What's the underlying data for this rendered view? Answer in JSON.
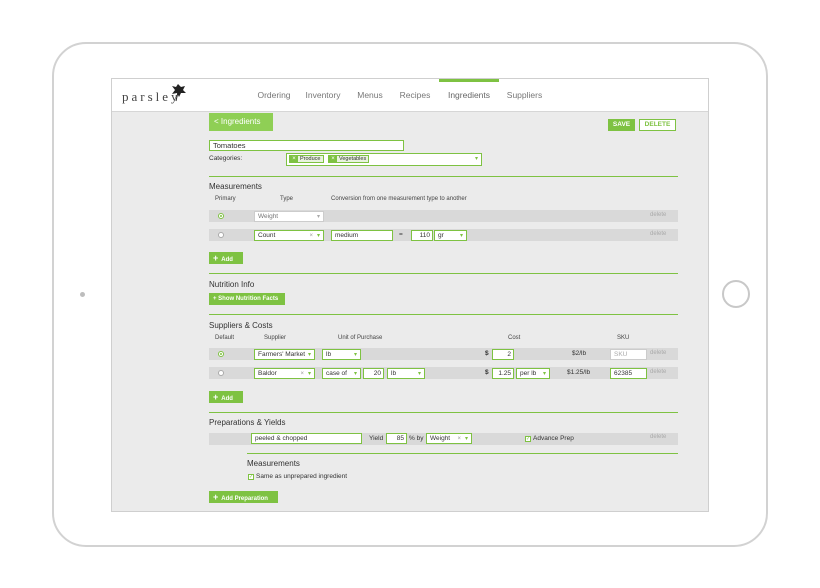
{
  "app": {
    "logo": "parsley"
  },
  "nav": [
    "Ordering",
    "Inventory",
    "Menus",
    "Recipes",
    "Ingredients",
    "Suppliers"
  ],
  "actions": {
    "back": "< Ingredients",
    "save": "SAVE",
    "delete": "DELETE"
  },
  "ingredient": {
    "name": "Tomatoes",
    "categories_label": "Categories:",
    "categories": [
      "Produce",
      "Vegetables"
    ]
  },
  "measurements": {
    "title": "Measurements",
    "headers": {
      "primary": "Primary",
      "type": "Type",
      "conversion": "Conversion from one measurement type to another"
    },
    "rows": [
      {
        "type": "Weight",
        "delete": "delete"
      },
      {
        "type": "Count",
        "unit_name": "medium",
        "equals": "=",
        "amount": "110",
        "unit": "gr",
        "delete": "delete"
      }
    ],
    "add": "Add"
  },
  "nutrition": {
    "title": "Nutrition Info",
    "button": "+ Show Nutrition Facts"
  },
  "suppliers": {
    "title": "Suppliers & Costs",
    "headers": {
      "default": "Default",
      "supplier": "Supplier",
      "unit": "Unit of Purchase",
      "cost": "Cost",
      "sku": "SKU"
    },
    "rows": [
      {
        "supplier": "Farmers' Market",
        "unit": "lb",
        "currency": "$",
        "cost": "2",
        "per_unit": "$2/lb",
        "sku_placeholder": "SKU (Optio",
        "delete": "delete"
      },
      {
        "supplier": "Baldor",
        "unit": "case of",
        "qty": "20",
        "qty_unit": "lb",
        "currency": "$",
        "cost": "1.25",
        "per": "per lb",
        "per_unit": "$1.25/lb",
        "sku": "62385",
        "delete": "delete"
      }
    ],
    "add": "Add"
  },
  "preparations": {
    "title": "Preparations & Yields",
    "row": {
      "name": "peeled & chopped",
      "yield_label": "Yield",
      "yield": "85",
      "by": "% by",
      "basis": "Weight",
      "advance": "Advance Prep",
      "delete": "delete"
    },
    "measurements_title": "Measurements",
    "same_as": "Same as unprepared ingredient",
    "add": "Add Preparation"
  },
  "colors": {
    "accent": "#7ec242",
    "background": "#ebebeb"
  }
}
